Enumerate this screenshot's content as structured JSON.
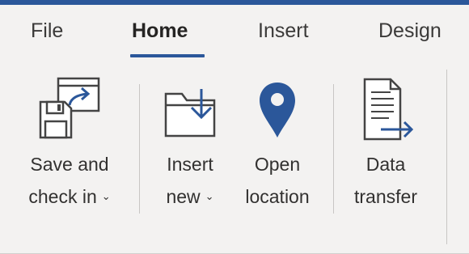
{
  "tabs": {
    "file": "File",
    "home": "Home",
    "insert": "Insert",
    "design": "Design"
  },
  "ribbon": {
    "save_check_in": {
      "line1": "Save and",
      "line2": "check in"
    },
    "insert_new": {
      "line1": "Insert",
      "line2": "new"
    },
    "open_location": {
      "line1": "Open",
      "line2": "location"
    },
    "data_transfer": {
      "line1": "Data",
      "line2": "transfer"
    }
  },
  "colors": {
    "accent": "#2b579a",
    "icon_stroke": "#444444",
    "background": "#f3f2f1"
  },
  "icons": {
    "save_check_in": "save-check-in-icon",
    "insert_new": "folder-download-icon",
    "open_location": "map-pin-icon",
    "data_transfer": "document-arrow-icon"
  }
}
